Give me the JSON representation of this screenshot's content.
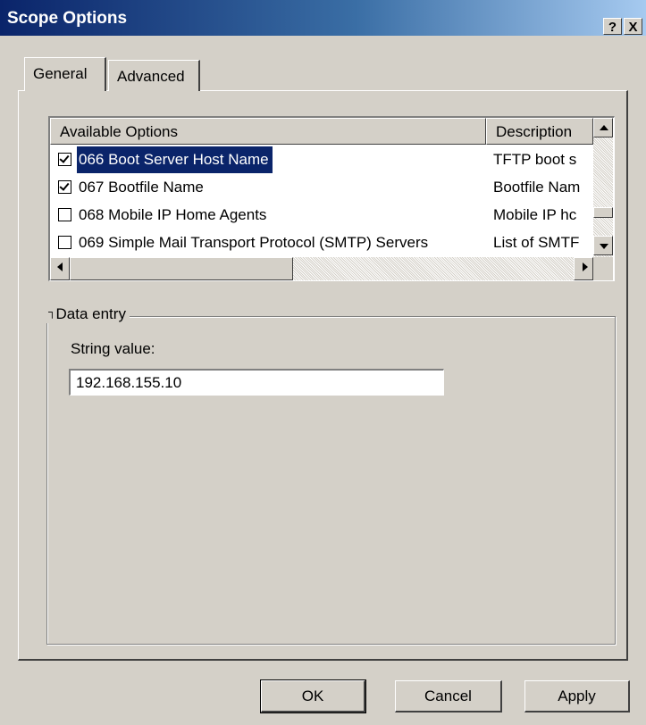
{
  "window": {
    "title": "Scope Options",
    "help_btn": "?",
    "close_btn": "X"
  },
  "tabs": [
    {
      "label": "General",
      "active": true
    },
    {
      "label": "Advanced",
      "active": false
    }
  ],
  "options_list": {
    "headers": {
      "name": "Available Options",
      "description": "Description"
    },
    "rows": [
      {
        "checked": true,
        "selected": true,
        "name": "066 Boot Server Host Name",
        "description": "TFTP boot s"
      },
      {
        "checked": true,
        "selected": false,
        "name": "067 Bootfile Name",
        "description": "Bootfile Nam"
      },
      {
        "checked": false,
        "selected": false,
        "name": "068 Mobile IP Home Agents",
        "description": "Mobile IP hc"
      },
      {
        "checked": false,
        "selected": false,
        "name": "069 Simple Mail Transport Protocol (SMTP) Servers",
        "description": "List of SMTF"
      }
    ]
  },
  "data_entry": {
    "legend": "Data entry",
    "field_label": "String value:",
    "value": "192.168.155.10"
  },
  "buttons": {
    "ok": "OK",
    "cancel": "Cancel",
    "apply": "Apply"
  }
}
